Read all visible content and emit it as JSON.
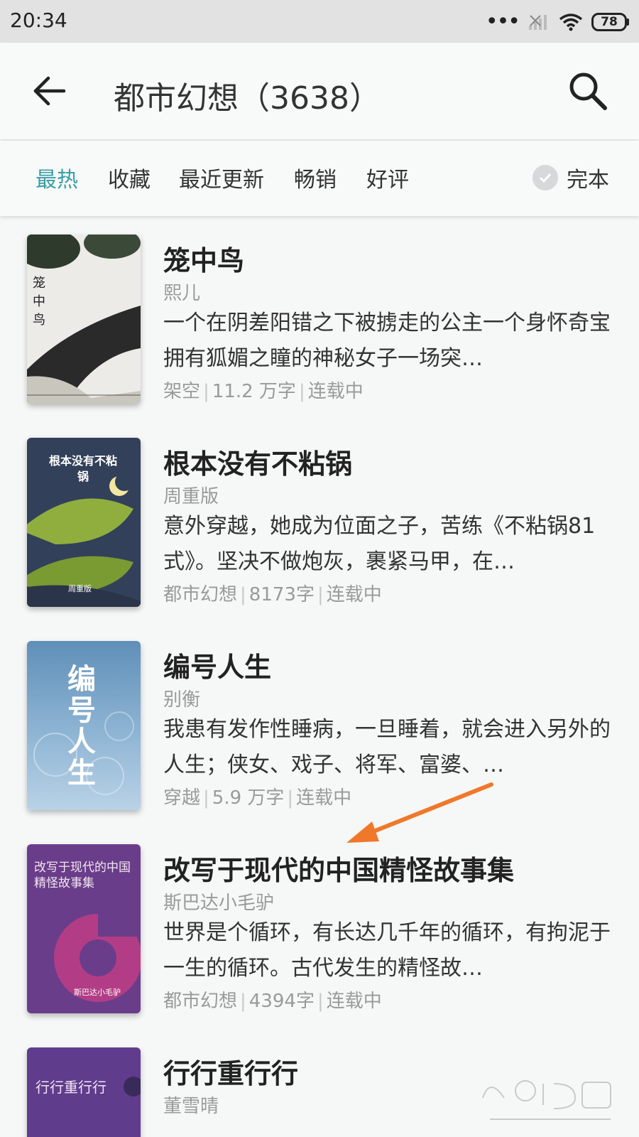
{
  "status_bar": {
    "time": "20:34",
    "battery": "78"
  },
  "header": {
    "title": "都市幻想（3638）",
    "back_icon": "arrow-left-icon",
    "search_icon": "search-icon"
  },
  "filters": {
    "tabs": [
      "最热",
      "收藏",
      "最近更新",
      "畅销",
      "好评"
    ],
    "active_tab": "最热",
    "complete_label": "完本"
  },
  "books": [
    {
      "title": "笼中鸟",
      "author": "熙儿",
      "description": "一个在阴差阳错之下被掳走的公主一个身怀奇宝拥有狐媚之瞳的神秘女子一场突…",
      "genre": "架空",
      "words": "11.2 万字",
      "status": "连载中",
      "cover_text": "笼中鸟"
    },
    {
      "title": "根本没有不粘锅",
      "author": "周重版",
      "description": "意外穿越，她成为位面之子，苦练《不粘锅81式》。坚决不做炮灰，裹紧马甲，在…",
      "genre": "都市幻想",
      "words": "8173字",
      "status": "连载中",
      "cover_text": "根本没有不粘锅",
      "cover_author": "周重版"
    },
    {
      "title": "编号人生",
      "author": "别衡",
      "description": "我患有发作性睡病，一旦睡着，就会进入另外的人生；侠女、戏子、将军、富婆、…",
      "genre": "穿越",
      "words": "5.9 万字",
      "status": "连载中",
      "cover_text": "编号人生"
    },
    {
      "title": "改写于现代的中国精怪故事集",
      "author": "斯巴达小毛驴",
      "description": "世界是个循环，有长达几千年的循环，有拘泥于一生的循环。古代发生的精怪故…",
      "genre": "都市幻想",
      "words": "4394字",
      "status": "连载中",
      "cover_text": "改写于现代的中国精怪故事集",
      "cover_author": "斯巴达小毛驴"
    },
    {
      "title": "行行重行行",
      "author": "董雪晴",
      "cover_text": "行行重行行"
    }
  ],
  "colors": {
    "accent": "#3a9ea7",
    "annotation_arrow": "#f0782a"
  }
}
